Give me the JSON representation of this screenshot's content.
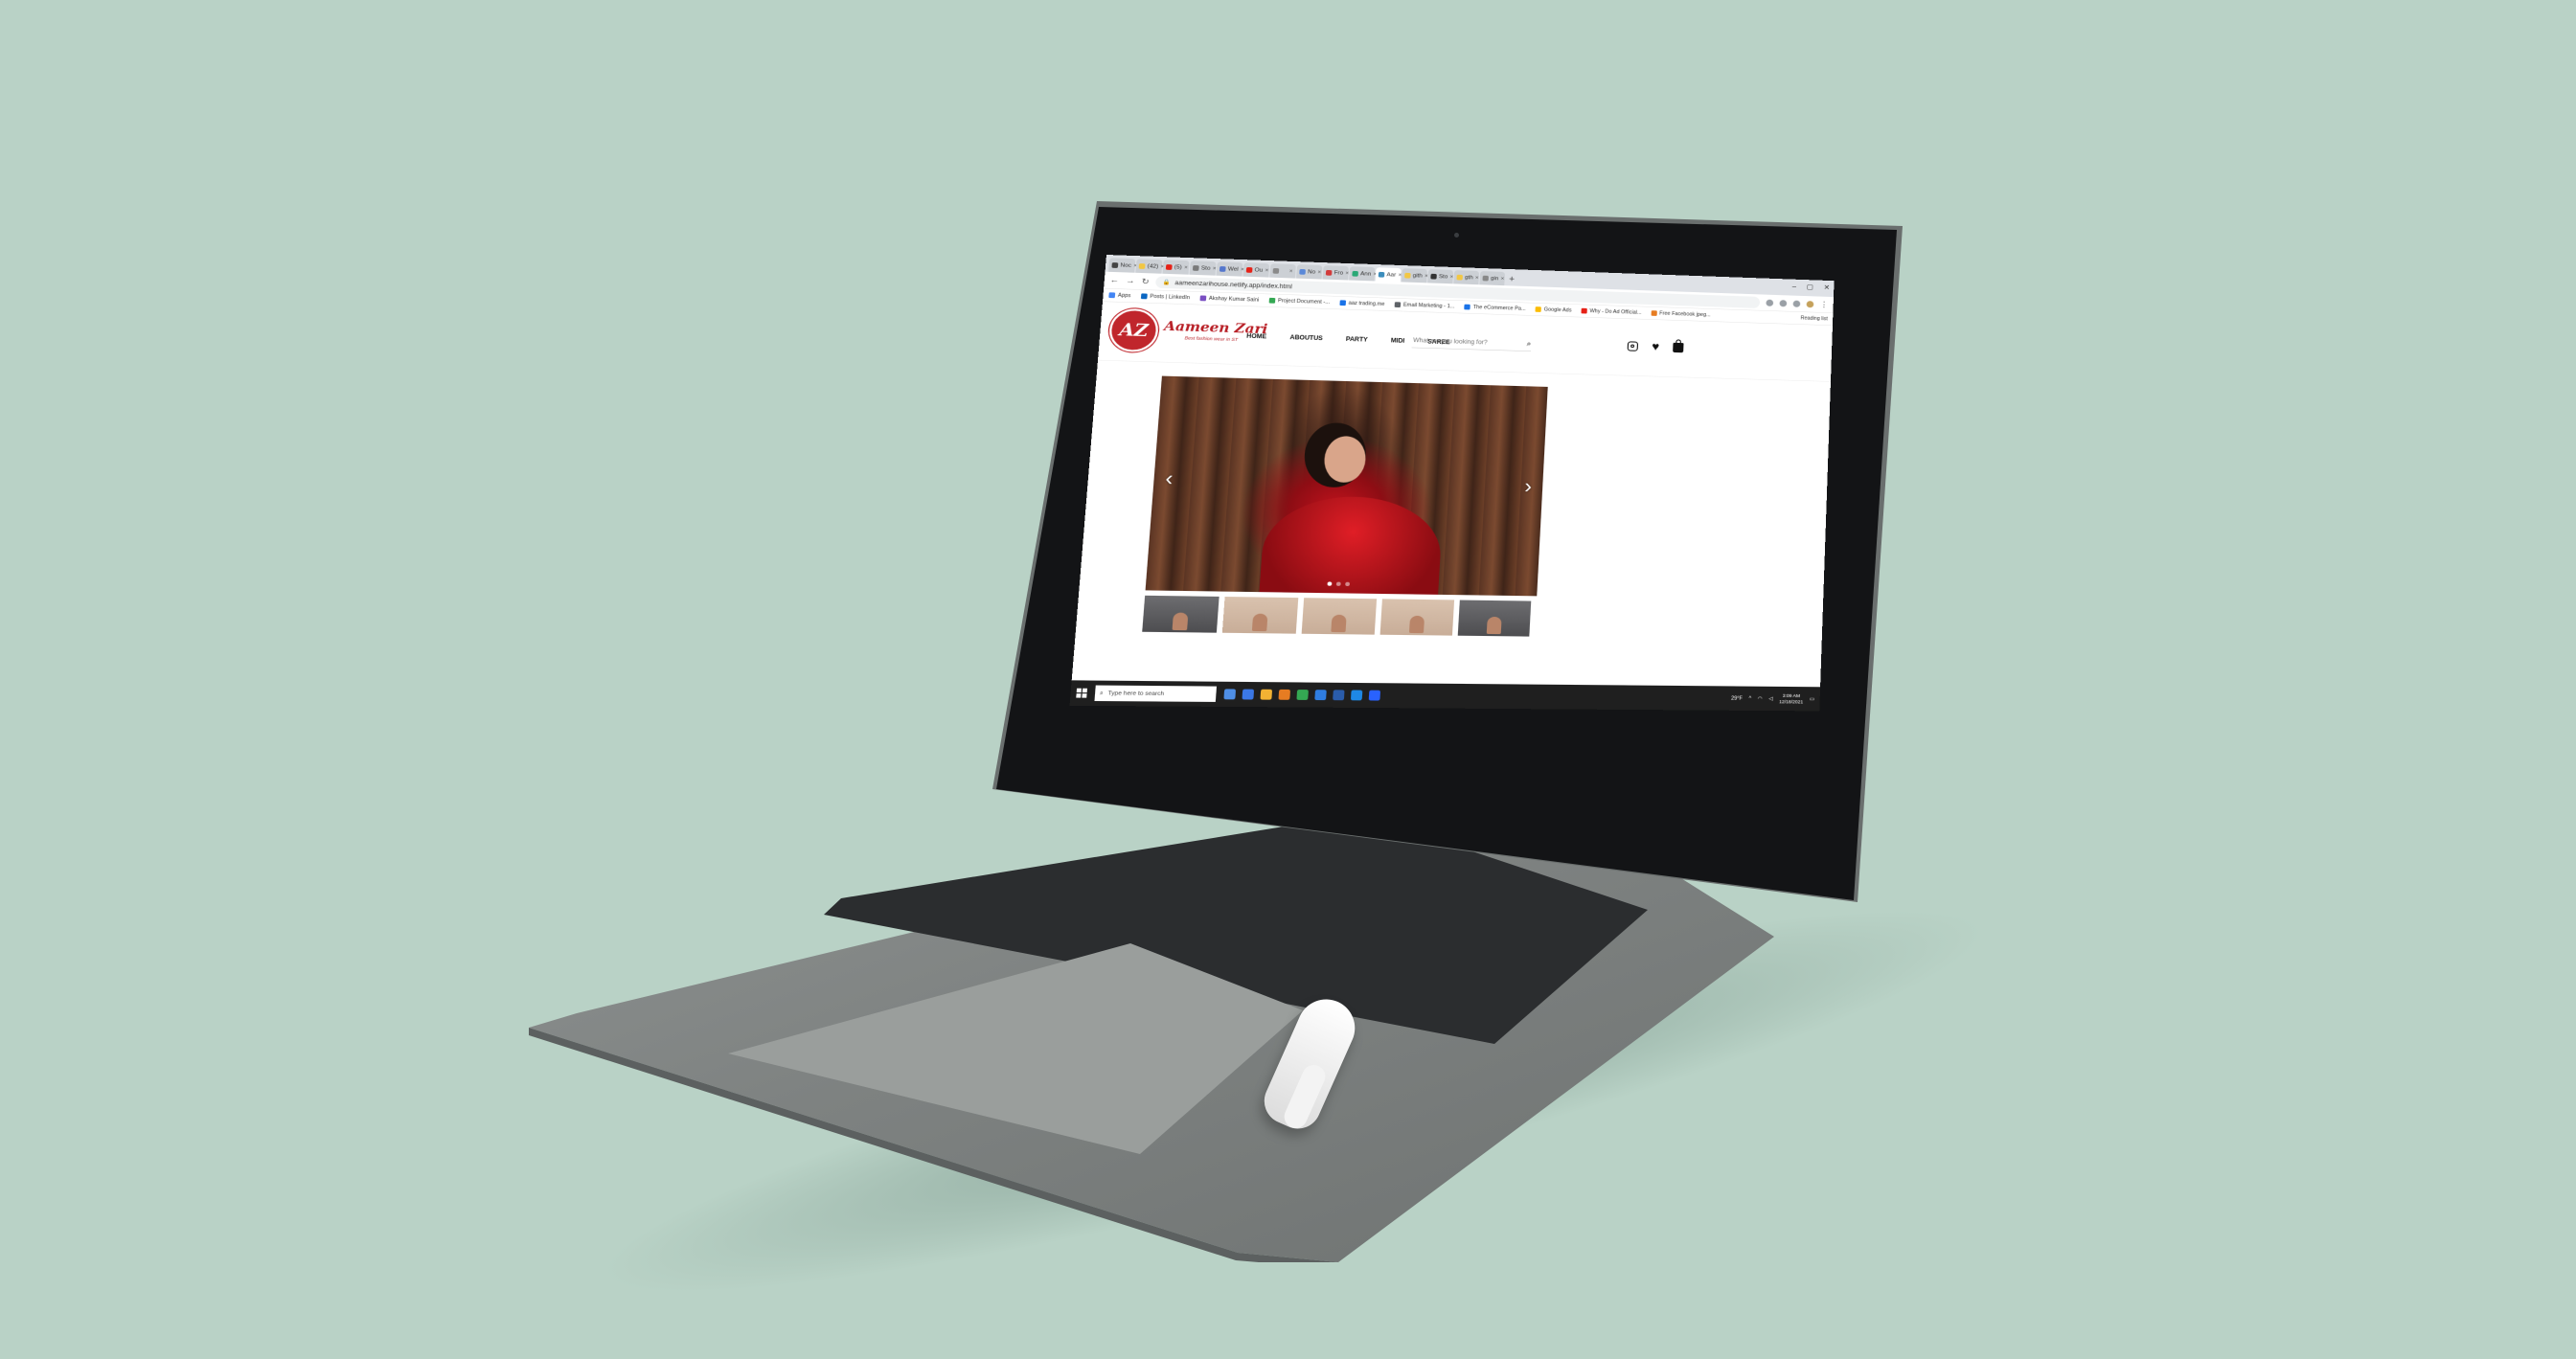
{
  "browser": {
    "tabs": [
      {
        "label": "Noc",
        "color": "#444444"
      },
      {
        "label": "(42)",
        "color": "#f2c744"
      },
      {
        "label": "(5)",
        "color": "#e62117"
      },
      {
        "label": "Sto",
        "color": "#7a7a7a"
      },
      {
        "label": "Wel",
        "color": "#5577cc"
      },
      {
        "label": "Ou",
        "color": "#e62117"
      },
      {
        "label": "",
        "color": "#8a8a8a"
      },
      {
        "label": "No",
        "color": "#5a88d8"
      },
      {
        "label": "Fro",
        "color": "#d23b3b"
      },
      {
        "label": "Ann",
        "color": "#2aa876"
      },
      {
        "label": "Aar",
        "color": "#3c8dbc",
        "active": true
      },
      {
        "label": "gith",
        "color": "#f2c744"
      },
      {
        "label": "Sto",
        "color": "#333333"
      },
      {
        "label": "gth",
        "color": "#f2c744"
      },
      {
        "label": "gin",
        "color": "#888888"
      }
    ],
    "address": "aameenzarihouse.netlify.app/index.html",
    "bookmarks": [
      {
        "label": "Apps",
        "color": "#4285f4"
      },
      {
        "label": "Posts | LinkedIn",
        "color": "#0a66c2"
      },
      {
        "label": "Akshay Kumar Saini",
        "color": "#7a4fc2"
      },
      {
        "label": "Project Document -...",
        "color": "#34a853"
      },
      {
        "label": "aaz trading.me",
        "color": "#1a73e8"
      },
      {
        "label": "Email Marketing - 1...",
        "color": "#5f6368"
      },
      {
        "label": "The eCommerce Pa...",
        "color": "#1a73e8"
      },
      {
        "label": "Google Ads",
        "color": "#fbbc04"
      },
      {
        "label": "Why - Do Ad Official...",
        "color": "#e62117"
      },
      {
        "label": "Free Facebook jpeg...",
        "color": "#e67c22"
      }
    ],
    "reading_list": "Reading list"
  },
  "site": {
    "logo_initials": "AZ",
    "brand": "Aameen Zari",
    "tagline": "Best fashion wear in ST",
    "nav": [
      "HOME",
      "ABOUTUS",
      "PARTY",
      "MIDI",
      "SAREE"
    ],
    "search_placeholder": "What are you looking for?"
  },
  "carousel": {
    "slide_count": 3,
    "active_index": 0
  },
  "taskbar": {
    "search_placeholder": "Type here to search",
    "temperature": "29°F",
    "time": "3:09 AM",
    "date": "12/18/2021",
    "apps": [
      "#4f8fe6",
      "#3b78e7",
      "#f2b233",
      "#e67c22",
      "#34a853",
      "#2f7de1",
      "#2a5caa",
      "#1e88e5",
      "#2962ff"
    ]
  }
}
